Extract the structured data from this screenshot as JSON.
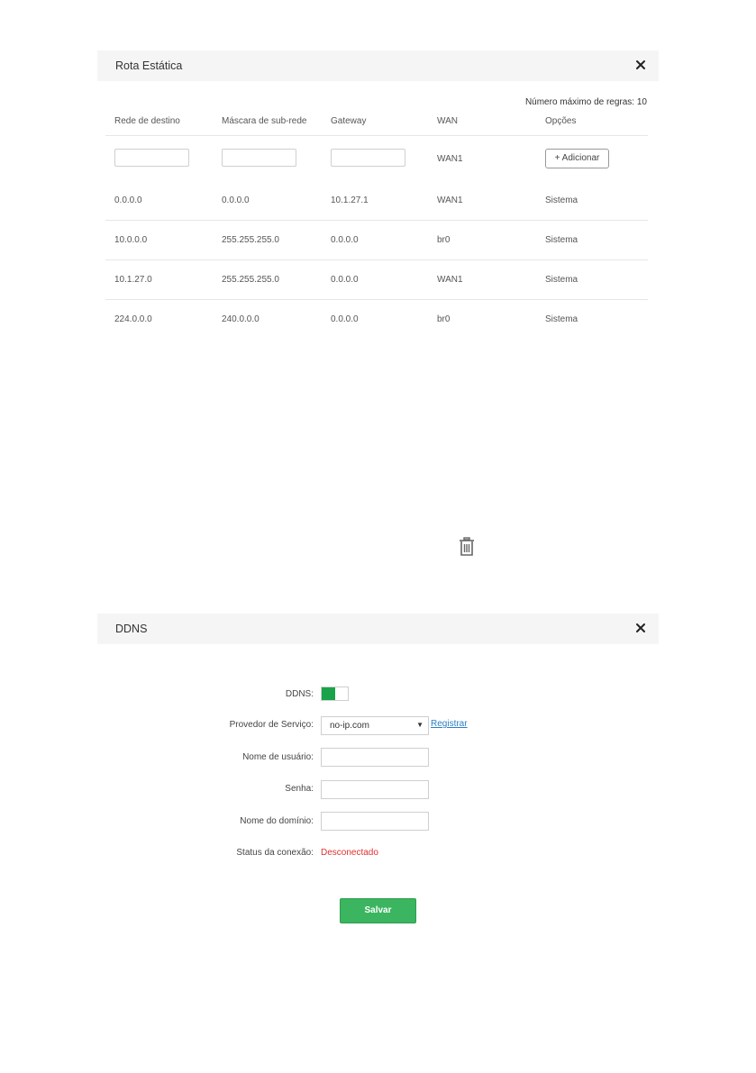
{
  "static_route": {
    "title": "Rota Estática",
    "max_rules_label": "Número máximo de regras: 10",
    "columns": [
      "Rede de destino",
      "Máscara de sub-rede",
      "Gateway",
      "WAN",
      "Opções"
    ],
    "new_row": {
      "destination_value": "",
      "mask_value": "",
      "gateway_value": "",
      "wan": "WAN1",
      "add_button": "+ Adicionar"
    },
    "rows": [
      [
        "0.0.0.0",
        "0.0.0.0",
        "10.1.27.1",
        "WAN1",
        "Sistema"
      ],
      [
        "10.0.0.0",
        "255.255.255.0",
        "0.0.0.0",
        "br0",
        "Sistema"
      ],
      [
        "10.1.27.0",
        "255.255.255.0",
        "0.0.0.0",
        "WAN1",
        "Sistema"
      ],
      [
        "224.0.0.0",
        "240.0.0.0",
        "0.0.0.0",
        "br0",
        "Sistema"
      ]
    ]
  },
  "icons": {
    "close": "close-icon",
    "trash": "trash-icon",
    "caret": "chevron-down-icon"
  },
  "ddns": {
    "title": "DDNS",
    "toggle_label": "DDNS:",
    "toggle_on": true,
    "provider_label": "Provedor de Serviço:",
    "provider_value": "no-ip.com",
    "register_link": "Registrar",
    "username_label": "Nome de usuário:",
    "username_value": "",
    "password_label": "Senha:",
    "password_value": "",
    "domain_label": "Nome do domínio:",
    "domain_value": "",
    "status_label": "Status da conexão:",
    "status_value": "Desconectado",
    "save_button": "Salvar"
  },
  "colors": {
    "accent_green": "#1aa34a",
    "save_green": "#3bb55f",
    "status_red": "#e03030",
    "link_blue": "#2a7fc7",
    "header_bg": "#f5f5f5"
  }
}
